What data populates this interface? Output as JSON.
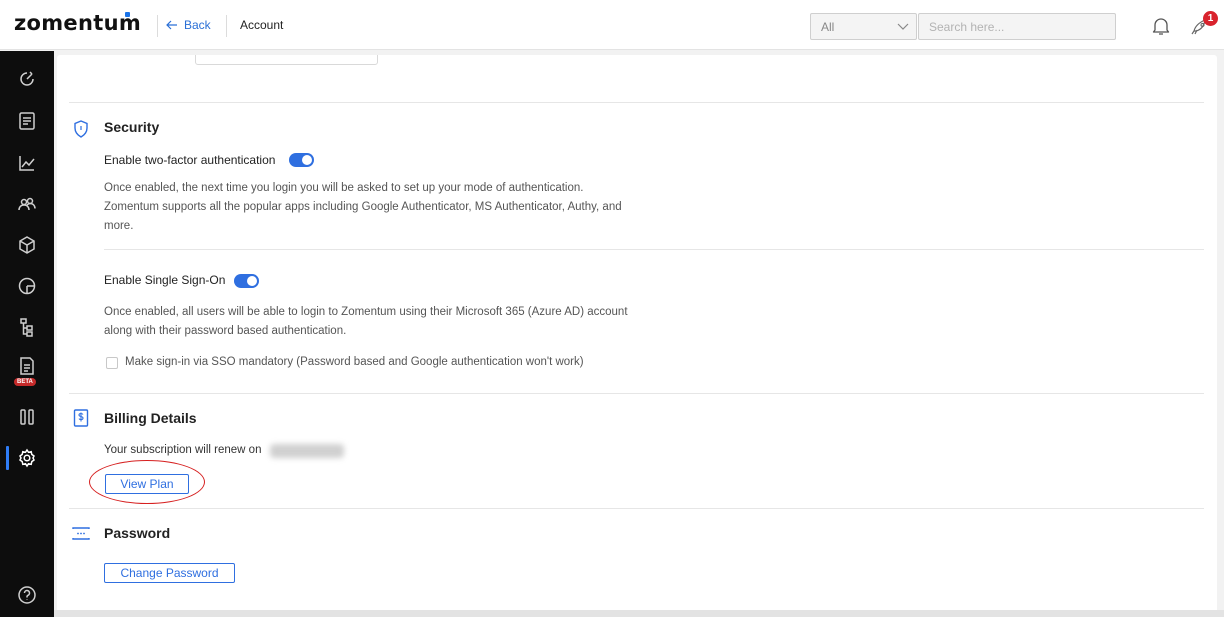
{
  "header": {
    "logo": "zomentum",
    "back_label": "Back",
    "breadcrumb": "Account",
    "filter_value": "All",
    "search_placeholder": "Search here...",
    "notification_count": "1"
  },
  "sidebar": {
    "items": [
      {
        "icon": "dashboard-icon"
      },
      {
        "icon": "document-icon"
      },
      {
        "icon": "chart-icon"
      },
      {
        "icon": "users-icon"
      },
      {
        "icon": "box-icon"
      },
      {
        "icon": "pie-chart-icon"
      },
      {
        "icon": "hierarchy-icon"
      },
      {
        "icon": "report-icon",
        "badge": "BETA"
      },
      {
        "icon": "columns-icon"
      },
      {
        "icon": "settings-icon",
        "active": true
      },
      {
        "icon": "help-icon"
      }
    ],
    "beta_label": "BETA"
  },
  "security": {
    "title": "Security",
    "two_factor_label": "Enable two-factor authentication",
    "two_factor_enabled": true,
    "two_factor_desc_line1": "Once enabled, the next time you login you will be asked to set up your mode of authentication.",
    "two_factor_desc_line2": "Zomentum supports all the popular apps including Google Authenticator, MS Authenticator, Authy, and",
    "two_factor_desc_line3": "more.",
    "sso_label": "Enable Single Sign-On",
    "sso_enabled": true,
    "sso_desc_line1": "Once enabled, all users will be able to login to Zomentum using their Microsoft 365 (Azure AD) account",
    "sso_desc_line2": "along with their password based authentication.",
    "sso_mandatory_label": "Make sign-in via SSO mandatory (Password based and Google authentication won't work)",
    "sso_mandatory_checked": false
  },
  "billing": {
    "title": "Billing Details",
    "renew_text": "Your subscription will renew on",
    "view_plan_label": "View Plan"
  },
  "password": {
    "title": "Password",
    "change_label": "Change Password"
  },
  "colors": {
    "accent": "#2f6fe0",
    "sidebar_bg": "#0d0d0d",
    "badge": "#d9232d",
    "annotation": "#d62020"
  }
}
